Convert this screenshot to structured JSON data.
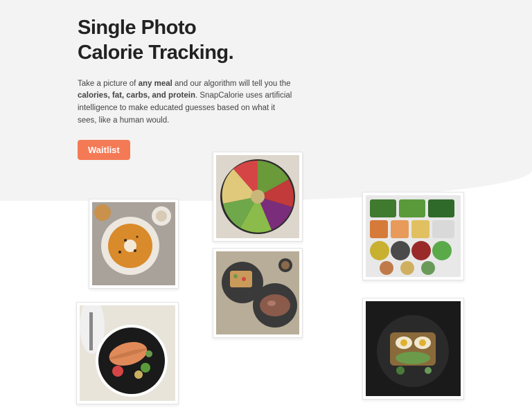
{
  "hero": {
    "title_line1": "Single Photo",
    "title_line2": "Calorie Tracking.",
    "desc_1": "Take a picture of ",
    "desc_bold1": "any meal",
    "desc_2": " and our algorithm will tell you the ",
    "desc_bold2": "calories, fat, carbs, and protein",
    "desc_3": ". SnapCalorie uses artificial intelligence to make educated guesses based on what it sees, like a human would.",
    "cta": "Waitlist"
  },
  "photos": [
    {
      "name": "soup-bowl"
    },
    {
      "name": "buddha-bowl"
    },
    {
      "name": "salad-bar"
    },
    {
      "name": "toast-plates"
    },
    {
      "name": "salmon-dish"
    },
    {
      "name": "egg-avocado-toast"
    }
  ],
  "colors": {
    "accent": "#f47a56",
    "bg_light": "#f3f3f3"
  }
}
